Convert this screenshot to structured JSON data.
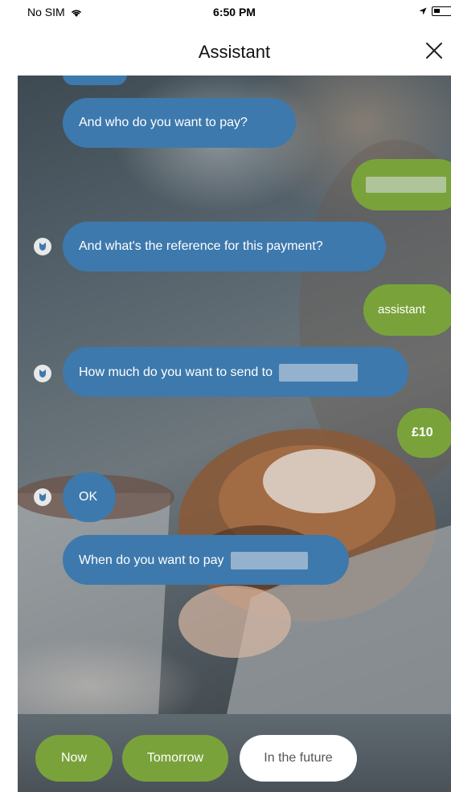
{
  "status_bar": {
    "carrier": "No SIM",
    "time": "6:50 PM",
    "icons": [
      "wifi-icon",
      "location-icon",
      "battery-icon"
    ]
  },
  "header": {
    "title": "Assistant",
    "close_icon": "close-icon"
  },
  "messages": [
    {
      "sender": "assistant",
      "text": "And who do you want to pay?"
    },
    {
      "sender": "user",
      "text": ""
    },
    {
      "sender": "assistant",
      "text": "And what's the reference for this payment?"
    },
    {
      "sender": "user",
      "text": "assistant"
    },
    {
      "sender": "assistant",
      "text": "How much do you want to send to"
    },
    {
      "sender": "user",
      "text": "£10"
    },
    {
      "sender": "assistant",
      "text": "OK"
    },
    {
      "sender": "assistant",
      "text": "When do you want to pay"
    }
  ],
  "quick_replies": [
    "Now",
    "Tomorrow",
    "In the future"
  ],
  "colors": {
    "assistant_bubble": "#3d79ad",
    "user_bubble": "#79a33a",
    "quick_reply_selected": "#79a33a",
    "quick_reply_default": "#ffffff"
  }
}
